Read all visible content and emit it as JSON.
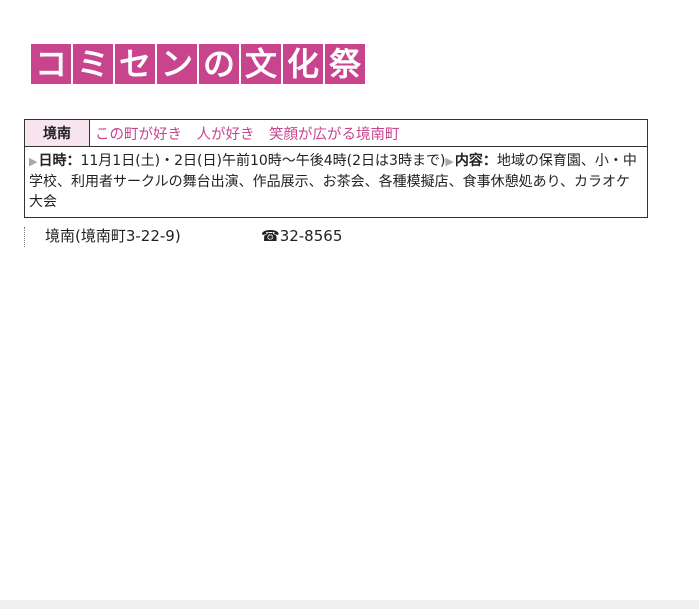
{
  "title": {
    "chars": [
      "コ",
      "ミ",
      "セ",
      "ン",
      "の",
      "文",
      "化",
      "祭"
    ],
    "color": "#c8458e"
  },
  "event": {
    "area": "境南",
    "catchphrase": "この町が好き　人が好き　笑顔が広がる境南町",
    "date_label": "日時：",
    "date_value": "11月1日(土)・2日(日)午前10時〜午後4時(2日は3時まで)",
    "content_label": "内容：",
    "content_value": "地域の保育園、小・中学校、利用者サークルの舞台出演、作品展示、お茶会、各種模擬店、食事休憩処あり、カラオケ大会",
    "arrow_icon": "▶"
  },
  "footer": {
    "venue": "境南(境南町3-22-9)",
    "phone_icon": "☎",
    "phone": "32-8565"
  }
}
